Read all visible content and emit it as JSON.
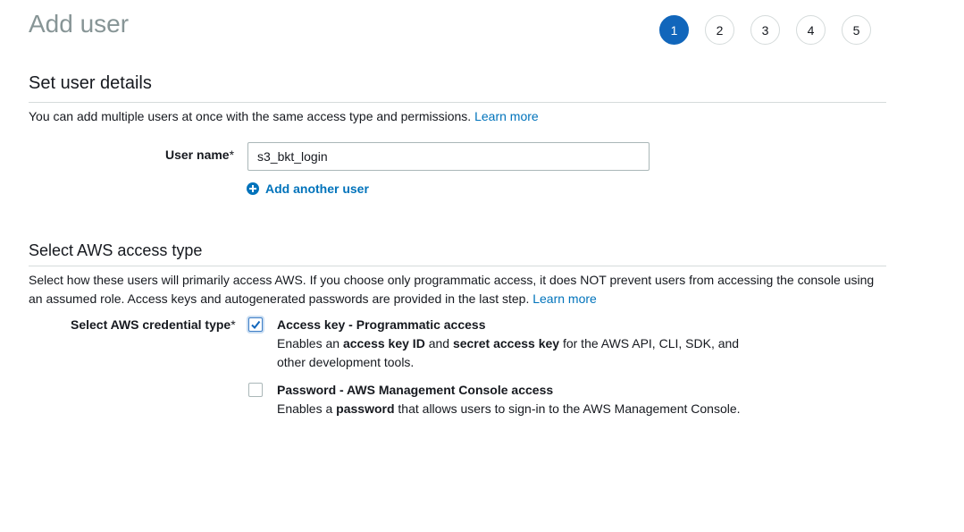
{
  "page": {
    "title": "Add user"
  },
  "steps": [
    "1",
    "2",
    "3",
    "4",
    "5"
  ],
  "active_step": "1",
  "colors": {
    "accent": "#1166bb",
    "link": "#0073bb",
    "muted_title": "#879596"
  },
  "details": {
    "heading": "Set user details",
    "description": "You can add multiple users at once with the same access type and permissions.",
    "learn_more": "Learn more",
    "username_label": "User name",
    "required_mark": "*",
    "username_value": "s3_bkt_login",
    "add_another_label": "Add another user",
    "add_icon": "plus-circle-icon"
  },
  "access": {
    "heading": "Select AWS access type",
    "description": "Select how these users will primarily access AWS. If you choose only programmatic access, it does NOT prevent users from accessing the console using an assumed role. Access keys and autogenerated passwords are provided in the last step.",
    "learn_more": "Learn more",
    "credential_label": "Select AWS credential type",
    "required_mark": "*",
    "options": [
      {
        "title": "Access key - Programmatic access",
        "checked": true,
        "desc_parts": [
          "Enables an ",
          "access key ID",
          " and ",
          "secret access key",
          " for the AWS API, CLI, SDK, and other development tools."
        ]
      },
      {
        "title": "Password - AWS Management Console access",
        "checked": false,
        "desc_parts": [
          "Enables a ",
          "password",
          " that allows users to sign-in to the AWS Management Console."
        ]
      }
    ]
  }
}
